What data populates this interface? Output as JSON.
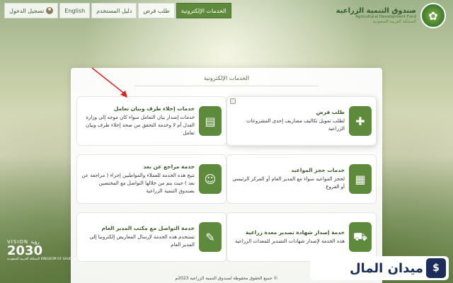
{
  "nav": {
    "items": [
      {
        "label": "الخدمات الإلكترونية",
        "active": true
      },
      {
        "label": "طلب قرض"
      },
      {
        "label": "دليل المستخدم"
      },
      {
        "label": "English"
      },
      {
        "label": "تسجيل الدخول"
      }
    ]
  },
  "logo": {
    "name_ar": "صندوق التنمية الزراعية",
    "name_en": "Agricultural Development Fund",
    "country": "المملكة العربية السعودية"
  },
  "panel": {
    "title": "الخدمات الإلكترونية",
    "cards": [
      {
        "title": "طلب قرض",
        "desc": "لطلب تمويل تكاليف مصاريف إحدى المشروعات الزراعية",
        "icon": "loan-request-icon"
      },
      {
        "title": "خدمات إخلاء طرف وبيان تعامل",
        "desc": "خدمات إصدار بيان التعامل سواء كان موجه إلى وزارة العدل أم لا وخدمة التحقق من صحة إخلاء طرف وبيان تعامل",
        "icon": "clearance-icon"
      },
      {
        "title": "خدمات حجز المواعيد",
        "desc": "لحجز المواعيد سواء مع المدير العام أو المركز الرئيسي أو الفروع",
        "icon": "calendar-icon"
      },
      {
        "title": "خدمة مراجع عن بعد",
        "desc": "تتيح هذه الخدمة للعملاء والمواطنين إجراء ( مراجعة عن بعد ) حيث يتم من خلالها التواصل مع المختصين بصندوق التنمية الزراعية",
        "icon": "remote-review-icon"
      },
      {
        "title": "خدمة إصدار شهادة تصدير معدة زراعية",
        "desc": "هذه الخدمة لإصدار شهادات التصدير للمعدات الزراعية",
        "icon": "tractor-icon"
      },
      {
        "title": "خدمة التواصل مع مكتب المدير العام",
        "desc": "تستخدم هذه الخدمة لإرسال المعاريض إلكترونيا إلى المدير العام",
        "icon": "document-pen-icon"
      }
    ]
  },
  "vision": {
    "top": "VISION رؤية",
    "number": "2030",
    "sub": "المملكة العربية السعودية KINGDOM OF SAUDI ARABIA"
  },
  "footer": {
    "text": "© جميع الحقوق محفوظة لصندوق التنمية الزراعية 2023م"
  },
  "watermark": {
    "text": "ميدان المال",
    "badge": "$"
  },
  "colors": {
    "primary": "#5d8a3b",
    "title_green": "#3b5a2b",
    "arrow": "#e02020"
  }
}
